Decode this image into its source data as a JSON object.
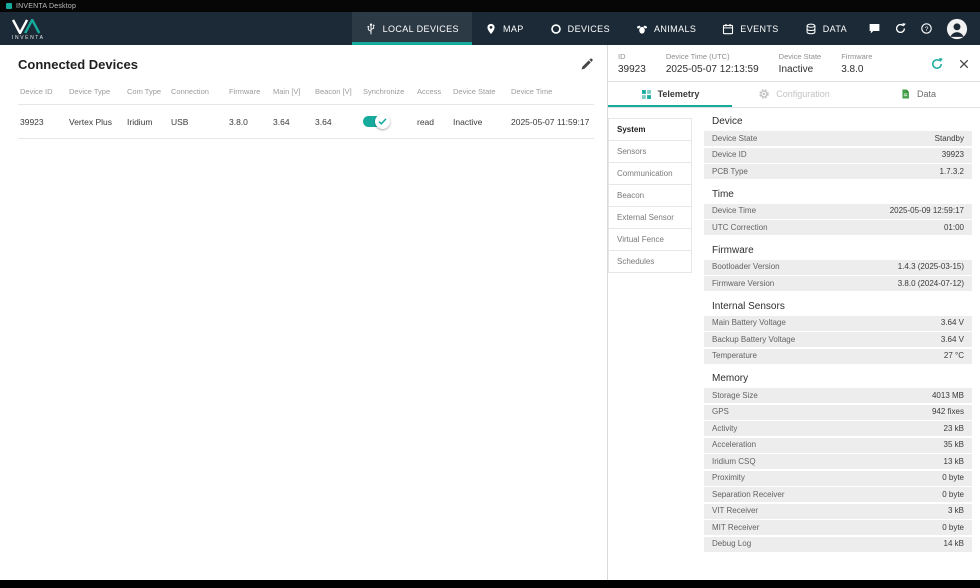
{
  "titlebar": {
    "title": "INVENTA Desktop"
  },
  "navbar": {
    "brand": {
      "name": "INVENTA"
    },
    "items": [
      {
        "label": "LOCAL DEVICES",
        "icon": "usb-icon",
        "active": true
      },
      {
        "label": "MAP",
        "icon": "map-pin-icon",
        "active": false
      },
      {
        "label": "DEVICES",
        "icon": "collar-ring-icon",
        "active": false
      },
      {
        "label": "ANIMALS",
        "icon": "animals-icon",
        "active": false
      },
      {
        "label": "EVENTS",
        "icon": "calendar-icon",
        "active": false
      },
      {
        "label": "DATA",
        "icon": "database-icon",
        "active": false
      }
    ],
    "action_icons": [
      "chat-icon",
      "sync-icon",
      "help-icon",
      "user-avatar"
    ]
  },
  "left_panel": {
    "title": "Connected Devices",
    "edit_icon": "pencil-icon",
    "table": {
      "columns": [
        "Device ID",
        "Device Type",
        "Com Type",
        "Connection",
        "Firmware",
        "Main [V]",
        "Beacon [V]",
        "Synchronize",
        "Access",
        "Device State",
        "Device Time"
      ],
      "rows": [
        {
          "device_id": "39923",
          "device_type": "Vertex Plus",
          "com_type": "Iridium",
          "connection": "USB",
          "firmware": "3.8.0",
          "main_v": "3.64",
          "beacon_v": "3.64",
          "synchronize_on": true,
          "access": "read",
          "device_state": "Inactive",
          "device_time": "2025-05-07 11:59:17"
        }
      ]
    }
  },
  "right_panel": {
    "header": {
      "fields": [
        {
          "label": "ID",
          "value": "39923"
        },
        {
          "label": "Device Time (UTC)",
          "value": "2025-05-07 12:13:59"
        },
        {
          "label": "Device State",
          "value": "Inactive"
        },
        {
          "label": "Firmware",
          "value": "3.8.0"
        }
      ],
      "actions": [
        "refresh-icon",
        "close-icon"
      ]
    },
    "tabs": [
      {
        "label": "Telemetry",
        "icon": "grid-icon",
        "state": "active"
      },
      {
        "label": "Configuration",
        "icon": "gear-icon",
        "state": "disabled"
      },
      {
        "label": "Data",
        "icon": "document-icon",
        "state": "normal"
      }
    ],
    "subnav": [
      {
        "label": "System",
        "active": true
      },
      {
        "label": "Sensors",
        "active": false
      },
      {
        "label": "Communication",
        "active": false
      },
      {
        "label": "Beacon",
        "active": false
      },
      {
        "label": "External Sensor",
        "active": false
      },
      {
        "label": "Virtual Fence",
        "active": false
      },
      {
        "label": "Schedules",
        "active": false
      }
    ],
    "sections": [
      {
        "title": "Device",
        "rows": [
          [
            "Device State",
            "Standby"
          ],
          [
            "Device ID",
            "39923"
          ],
          [
            "PCB Type",
            "1.7.3.2"
          ]
        ]
      },
      {
        "title": "Time",
        "rows": [
          [
            "Device Time",
            "2025-05-09 12:59:17"
          ],
          [
            "UTC Correction",
            "01:00"
          ]
        ]
      },
      {
        "title": "Firmware",
        "rows": [
          [
            "Bootloader Version",
            "1.4.3 (2025-03-15)"
          ],
          [
            "Firmware Version",
            "3.8.0 (2024-07-12)"
          ]
        ]
      },
      {
        "title": "Internal Sensors",
        "rows": [
          [
            "Main Battery Voltage",
            "3.64 V"
          ],
          [
            "Backup Battery Voltage",
            "3.64 V"
          ],
          [
            "Temperature",
            "27 °C"
          ]
        ]
      },
      {
        "title": "Memory",
        "rows": [
          [
            "Storage Size",
            "4013 MB"
          ],
          [
            "GPS",
            "942 fixes"
          ],
          [
            "Activity",
            "23 kB"
          ],
          [
            "Acceleration",
            "35 kB"
          ],
          [
            "Iridium CSQ",
            "13 kB"
          ],
          [
            "Proximity",
            "0 byte"
          ],
          [
            "Separation Receiver",
            "0 byte"
          ],
          [
            "VIT Receiver",
            "3 kB"
          ],
          [
            "MIT Receiver",
            "0 byte"
          ],
          [
            "Debug Log",
            "14 kB"
          ]
        ]
      }
    ]
  },
  "colors": {
    "accent_teal": "#17ab9e",
    "navbar_bg": "#1b2a36",
    "data_green": "#43a047",
    "row_bg": "#ededed"
  }
}
